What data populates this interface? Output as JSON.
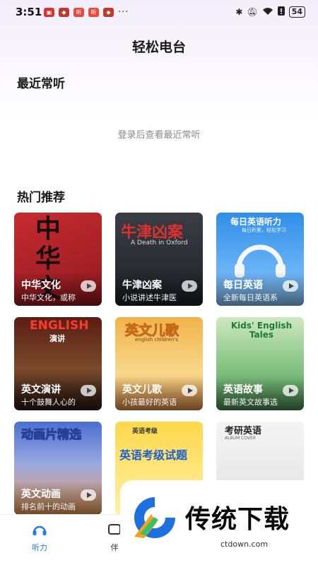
{
  "status_bar": {
    "time": "3:51",
    "battery": "54",
    "dots": "···"
  },
  "app_title": "轻松电台",
  "recent": {
    "title": "最近常听",
    "empty_text": "登录后查看最近常听"
  },
  "hot": {
    "title": "热门推荐",
    "cards": [
      {
        "name": "中华文化",
        "desc": "中华文化，或称",
        "cover_text": "中华文",
        "colors": [
          "#b7232a",
          "#d94a3c"
        ]
      },
      {
        "name": "牛津凶案",
        "desc": "小说讲述牛津医",
        "cover_text": "牛津凶案",
        "cover_sub": "A Death in Oxford",
        "colors": [
          "#2a2d34",
          "#585c66"
        ]
      },
      {
        "name": "每日英语",
        "desc": "全新每日英语系",
        "cover_text": "每日英语听力",
        "cover_sub": "每日积累，轻松学习",
        "colors": [
          "#2f8ee8",
          "#7cc5ff"
        ]
      },
      {
        "name": "英文演讲",
        "desc": "十个鼓舞人心的",
        "cover_text": "ENGLISH",
        "cover_sub": "演讲",
        "colors": [
          "#3b2418",
          "#8a5a34"
        ]
      },
      {
        "name": "英文儿歌",
        "desc": "小孩最好的英语",
        "cover_text": "英文儿歌",
        "cover_sub": "english children's",
        "colors": [
          "#f0a63a",
          "#f7d27a"
        ]
      },
      {
        "name": "英语故事",
        "desc": "最新英文故事选",
        "cover_text": "Kids' English Tales",
        "colors": [
          "#5fa96a",
          "#a9d9a0"
        ]
      },
      {
        "name": "英文动画",
        "desc": "排名前十的动画",
        "cover_text": "动画片精选",
        "colors": [
          "#4b6fc9",
          "#f0a05a"
        ]
      },
      {
        "name": "",
        "desc": "",
        "cover_text": "英语考级试题",
        "cover_sub": "英语考级",
        "colors": [
          "#ffd84a",
          "#fff1a8"
        ]
      },
      {
        "name": "",
        "desc": "",
        "cover_text": "考研英语",
        "cover_sub": "ALBUM COVER",
        "colors": [
          "#e9e9e9",
          "#ffffff"
        ]
      }
    ]
  },
  "bottom_nav": {
    "items": [
      {
        "label": "听力"
      },
      {
        "label": "伴"
      }
    ]
  },
  "watermark": {
    "text": "传统下载",
    "url": "ctdown.com"
  },
  "colors": {
    "accent": "#1f7cf0"
  }
}
